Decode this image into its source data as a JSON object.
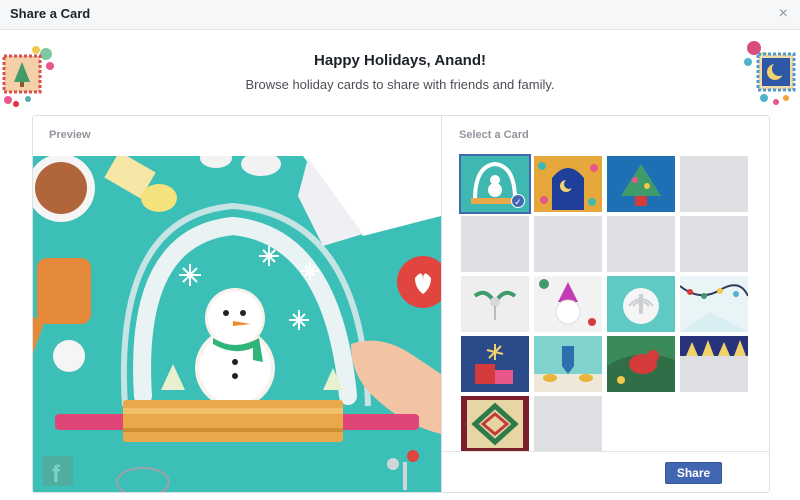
{
  "dialog": {
    "title": "Share a Card",
    "close_symbol": "×"
  },
  "header": {
    "heading": "Happy Holidays, Anand!",
    "subheading": "Browse holiday cards to share with friends and family."
  },
  "preview": {
    "label": "Preview",
    "image": "snowman-cookie-snow-globe-card",
    "brand_icon": "facebook-f-icon"
  },
  "selector": {
    "label": "Select a Card",
    "selected_index": 0,
    "cards": [
      {
        "name": "snowman-snow-globe-card",
        "status": "loaded",
        "bg": "#3fb8b2"
      },
      {
        "name": "moon-arch-card",
        "status": "loaded",
        "bg": "#e6a83a"
      },
      {
        "name": "tree-bird-card",
        "status": "loaded",
        "bg": "#1f6fb4"
      },
      {
        "name": "placeholder",
        "status": "loading",
        "bg": "#dddfe2"
      },
      {
        "name": "placeholder",
        "status": "loading",
        "bg": "#dddfe2"
      },
      {
        "name": "placeholder",
        "status": "loading",
        "bg": "#dddfe2"
      },
      {
        "name": "placeholder",
        "status": "loading",
        "bg": "#dddfe2"
      },
      {
        "name": "placeholder",
        "status": "loading",
        "bg": "#dddfe2"
      },
      {
        "name": "holly-angel-card",
        "status": "loaded",
        "bg": "#eeeeee"
      },
      {
        "name": "party-hat-snowman-card",
        "status": "loaded",
        "bg": "#f2f2f2"
      },
      {
        "name": "menorah-card",
        "status": "loaded",
        "bg": "#5fc9c3"
      },
      {
        "name": "string-lights-card",
        "status": "loaded",
        "bg": "#e9f4f7"
      },
      {
        "name": "gifts-sparkler-card",
        "status": "loaded",
        "bg": "#2a4a8a"
      },
      {
        "name": "dreidel-coins-card",
        "status": "loaded",
        "bg": "#7fd3cc"
      },
      {
        "name": "cardinal-bird-card",
        "status": "loaded",
        "bg": "#3b8a5a"
      },
      {
        "name": "pine-trees-card",
        "status": "partial",
        "bg": "#27337a"
      },
      {
        "name": "celtic-knot-card",
        "status": "loaded",
        "bg": "#7a1f2b"
      },
      {
        "name": "placeholder",
        "status": "loading",
        "bg": "#dddfe2"
      }
    ]
  },
  "actions": {
    "share_label": "Share"
  },
  "colors": {
    "accent": "#4267b2",
    "placeholder": "#dddfe2",
    "preview_bg": "#3cbfb6"
  }
}
